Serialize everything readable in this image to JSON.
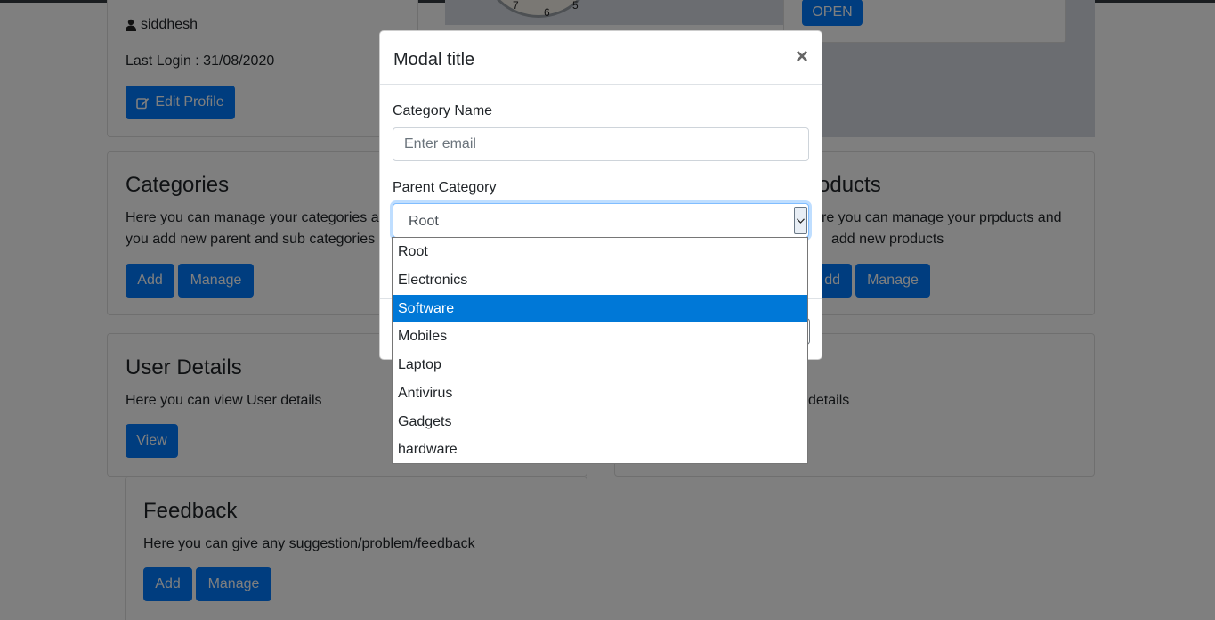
{
  "profile": {
    "username": "siddhesh",
    "last_login": "Last Login : 31/08/2020",
    "edit_button": "Edit Profile"
  },
  "clock": {
    "numbers": [
      "7",
      "6",
      "5"
    ]
  },
  "orders_card": {
    "open_button": "OPEN"
  },
  "categories_card": {
    "title": "Categories",
    "line1": "Here you can manage your categories ar",
    "line2": "you add new parent and sub categories",
    "add_button": "Add",
    "manage_button": "Manage"
  },
  "products_card": {
    "title": "oducts",
    "line1": "re you can manage your prpducts and",
    "line2": "add new products",
    "add_button": "dd",
    "manage_button": "Manage"
  },
  "user_details_card": {
    "title": "User Details",
    "text": "Here you can view User details",
    "view_button": "View"
  },
  "right_details_card": {
    "text": "details"
  },
  "feedback_card": {
    "title": "Feedback",
    "text": "Here you can give any suggestion/problem/feedback",
    "add_button": "Add",
    "manage_button": "Manage"
  },
  "modal": {
    "title": "Modal title",
    "close_glyph": "×",
    "category_name_label": "Category Name",
    "category_name_placeholder": "Enter email",
    "category_name_value": "",
    "parent_category_label": "Parent Category",
    "parent_category_selected": "Root"
  },
  "dropdown": {
    "options": [
      "Root",
      "Electronics",
      "Software",
      "Mobiles",
      "Laptop",
      "Antivirus",
      "Gadgets",
      "hardware"
    ],
    "highlighted_index": 2
  },
  "colors": {
    "primary": "#007bff",
    "highlight": "#0078d7",
    "backdrop": "rgba(0,0,0,0.5)"
  }
}
